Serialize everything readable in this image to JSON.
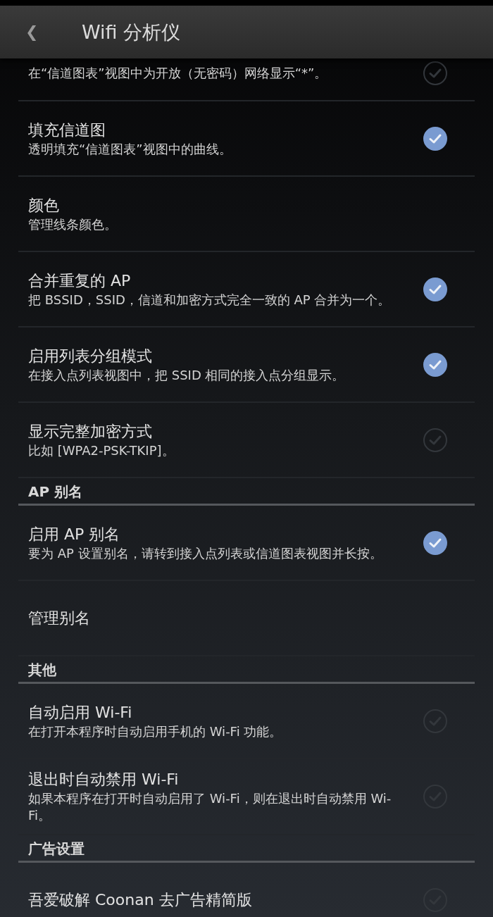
{
  "header": {
    "back": "❮",
    "title": "Wifi 分析仪"
  },
  "items": [
    {
      "kind": "pref",
      "summary": "在“信道图表”视图中为开放（无密码）网络显示“*”。",
      "checked": false
    },
    {
      "kind": "pref",
      "title": "填充信道图",
      "summary": "透明填充“信道图表”视图中的曲线。",
      "checked": true
    },
    {
      "kind": "pref",
      "title": "颜色",
      "summary": "管理线条颜色。"
    },
    {
      "kind": "pref",
      "title": "合并重复的 AP",
      "summary": "把 BSSID，SSID，信道和加密方式完全一致的 AP 合并为一个。",
      "checked": true
    },
    {
      "kind": "pref",
      "title": "启用列表分组模式",
      "summary": "在接入点列表视图中，把 SSID 相同的接入点分组显示。",
      "checked": true
    },
    {
      "kind": "pref",
      "title": "显示完整加密方式",
      "summary": "比如 [WPA2-PSK-TKIP]。",
      "checked": false
    },
    {
      "kind": "section",
      "title": "AP 别名"
    },
    {
      "kind": "pref",
      "title": "启用 AP 别名",
      "summary": "要为 AP 设置别名，请转到接入点列表或信道图表视图并长按。",
      "checked": true
    },
    {
      "kind": "pref",
      "title": "管理别名"
    },
    {
      "kind": "section",
      "title": "其他"
    },
    {
      "kind": "pref",
      "title": "自动启用 Wi-Fi",
      "summary": "在打开本程序时自动启用手机的 Wi-Fi 功能。",
      "checked": false
    },
    {
      "kind": "pref",
      "title": "退出时自动禁用 Wi-Fi",
      "summary": "如果本程序在打开时自动启用了 Wi-Fi，则在退出时自动禁用 Wi-Fi。",
      "checked": false
    },
    {
      "kind": "section",
      "title": "广告设置"
    },
    {
      "kind": "pref",
      "title": "吾爱破解 Coonan 去广告精简版",
      "checked": false
    }
  ]
}
